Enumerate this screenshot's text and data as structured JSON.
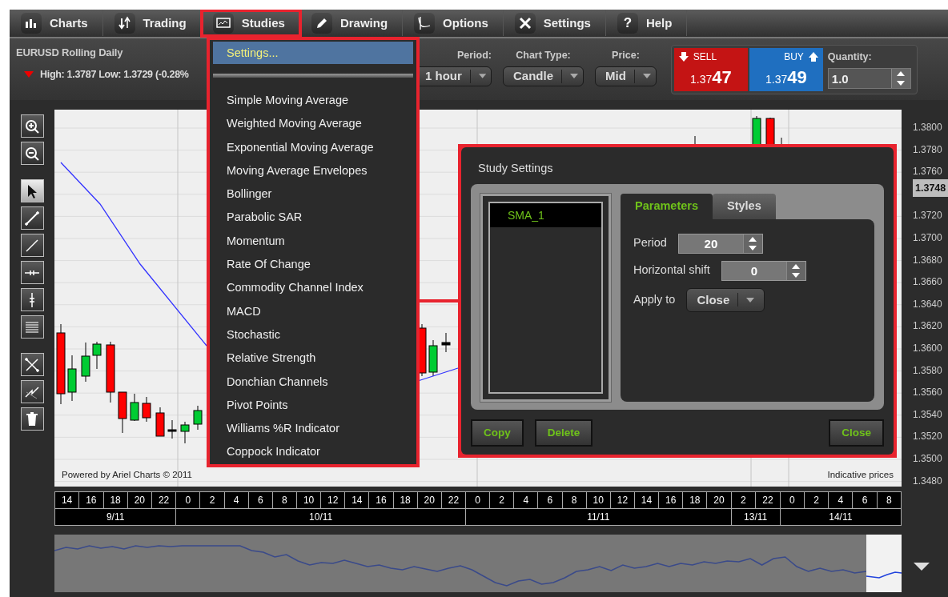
{
  "toolbar": {
    "items": [
      {
        "label": "Charts",
        "highlighted": false
      },
      {
        "label": "Trading",
        "highlighted": false
      },
      {
        "label": "Studies",
        "highlighted": true
      },
      {
        "label": "Drawing",
        "highlighted": false
      },
      {
        "label": "Options",
        "highlighted": false
      },
      {
        "label": "Settings",
        "highlighted": false
      },
      {
        "label": "Help",
        "glyph": "?",
        "highlighted": false
      }
    ]
  },
  "info": {
    "symbol": "EURUSD Rolling Daily",
    "falling": true,
    "summary": "High: 1.3787 Low: 1.3729 (-0.28%"
  },
  "selectors": [
    {
      "label": "Period:",
      "value": "1 hour"
    },
    {
      "label": "Chart Type:",
      "value": "Candle"
    },
    {
      "label": "Price:",
      "value": "Mid"
    }
  ],
  "trade": {
    "sell": {
      "label": "SELL",
      "price_main": "1.37",
      "price_pips": "47"
    },
    "buy": {
      "label": "BUY",
      "price_main": "1.37",
      "price_pips": "49"
    },
    "quantity": {
      "label": "Quantity:",
      "value": "1.0"
    }
  },
  "tools": [
    [
      {
        "selected": false
      },
      {
        "selected": false
      }
    ],
    [
      {
        "selected": true
      },
      {
        "selected": false
      },
      {
        "selected": false
      },
      {
        "selected": false
      },
      {
        "selected": false
      },
      {
        "selected": false
      }
    ],
    [
      {
        "selected": false
      },
      {
        "selected": false
      },
      {
        "selected": false
      }
    ]
  ],
  "chart": {
    "credit": "Powered by Ariel Charts © 2011",
    "note": "Indicative prices",
    "current_price": "1.3748",
    "y_axis": [
      "1.3800",
      "1.3780",
      "1.3760",
      "1.3720",
      "1.3700",
      "1.3680",
      "1.3660",
      "1.3640",
      "1.3620",
      "1.3600",
      "1.3580",
      "1.3560",
      "1.3540",
      "1.3520",
      "1.3500",
      "1.3480"
    ],
    "dates": [
      {
        "label": "9/11",
        "hours": [
          "14",
          "16",
          "18",
          "20",
          "22"
        ]
      },
      {
        "label": "10/11",
        "hours": [
          "0",
          "2",
          "4",
          "6",
          "8",
          "10",
          "12",
          "14",
          "16",
          "18",
          "20",
          "22"
        ]
      },
      {
        "label": "11/11",
        "hours": [
          "0",
          "2",
          "4",
          "6",
          "8",
          "10",
          "12",
          "14",
          "16",
          "18",
          "20"
        ]
      },
      {
        "label": "13/11",
        "hours": [
          "2",
          "22"
        ]
      },
      {
        "label": "14/11",
        "hours": [
          "0",
          "2",
          "4",
          "6",
          "8"
        ]
      }
    ]
  },
  "menu": {
    "highlighted": true,
    "items": [
      {
        "kind": "item",
        "label": "Settings...",
        "highlighted": true
      },
      {
        "kind": "separator"
      },
      {
        "kind": "item",
        "label": "Simple Moving Average",
        "highlighted": false
      },
      {
        "kind": "item",
        "label": "Weighted Moving Average",
        "highlighted": false
      },
      {
        "kind": "item",
        "label": "Exponential Moving Average",
        "highlighted": false
      },
      {
        "kind": "item",
        "label": "Moving Average Envelopes",
        "highlighted": false
      },
      {
        "kind": "item",
        "label": "Bollinger",
        "highlighted": false
      },
      {
        "kind": "item",
        "label": "Parabolic SAR",
        "highlighted": false
      },
      {
        "kind": "item",
        "label": "Momentum",
        "highlighted": false
      },
      {
        "kind": "item",
        "label": "Rate Of Change",
        "highlighted": false
      },
      {
        "kind": "item",
        "label": "Commodity Channel Index",
        "highlighted": false
      },
      {
        "kind": "item",
        "label": "MACD",
        "highlighted": false
      },
      {
        "kind": "item",
        "label": "Stochastic",
        "highlighted": false
      },
      {
        "kind": "item",
        "label": "Relative Strength",
        "highlighted": false
      },
      {
        "kind": "item",
        "label": "Donchian Channels",
        "highlighted": false
      },
      {
        "kind": "item",
        "label": "Pivot Points",
        "highlighted": false
      },
      {
        "kind": "item",
        "label": "Williams %R Indicator",
        "highlighted": false
      },
      {
        "kind": "item",
        "label": "Coppock Indicator",
        "highlighted": false
      }
    ]
  },
  "dialog": {
    "title": "Study Settings",
    "highlighted": true,
    "studies": [
      {
        "label": "SMA_1",
        "selected": true
      }
    ],
    "tabs": [
      {
        "label": "Parameters",
        "selected": true
      },
      {
        "label": "Styles",
        "selected": false
      }
    ],
    "params": [
      {
        "kind": "spinner",
        "label": "Period",
        "value": "20"
      },
      {
        "kind": "spinner",
        "label": "Horizontal shift",
        "value": "0"
      },
      {
        "kind": "select",
        "label": "Apply to",
        "value": "Close"
      }
    ],
    "buttons": [
      {
        "label": "Copy"
      },
      {
        "label": "Delete"
      },
      {
        "label": "Close"
      }
    ]
  }
}
